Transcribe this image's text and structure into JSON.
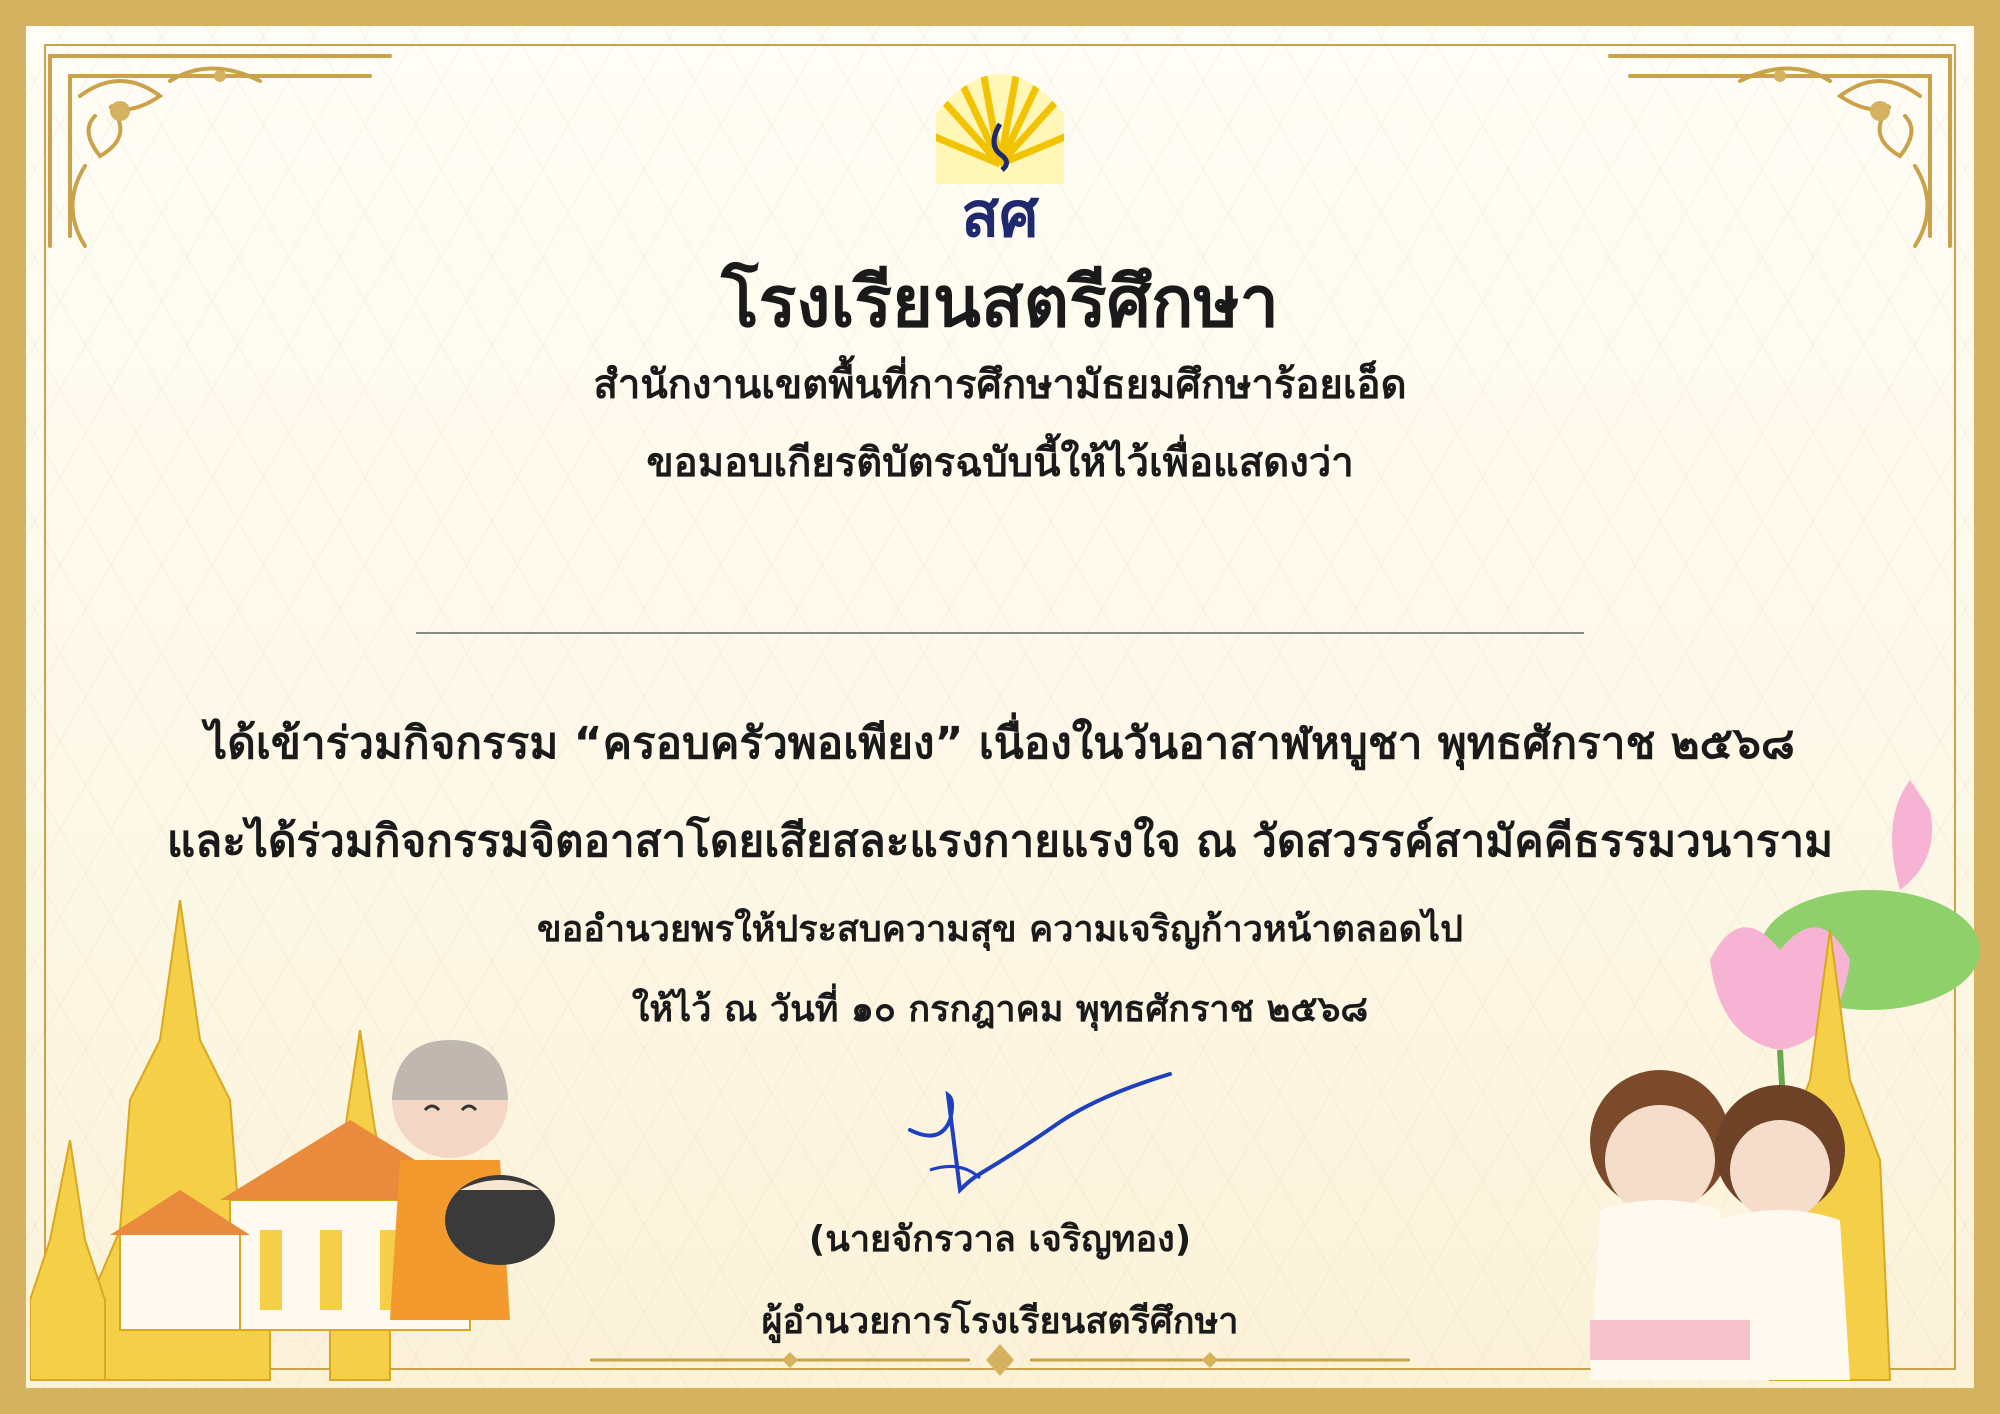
{
  "certificate": {
    "school_name": "โรงเรียนสตรีศึกษา",
    "office_name": "สำนักงานเขตพื้นที่การศึกษามัธยมศึกษาร้อยเอ็ด",
    "presentation_text": "ขอมอบเกียรติบัตรฉบับนี้ให้ไว้เพื่อแสดงว่า",
    "body_line1": "ได้เข้าร่วมกิจกรรม “ครอบครัวพอเพียง” เนื่องในวันอาสาฬหบูชา พุทธศักราช ๒๕๖๘",
    "body_line2": "และได้ร่วมกิจกรรมจิตอาสาโดยเสียสละแรงกายแรงใจ ณ วัดสวรรค์สามัคคีธรรมวนาราม",
    "wish_text": "ขออำนวยพรให้ประสบความสุข ความเจริญก้าวหน้าตลอดไป",
    "date_text": "ให้ไว้ ณ วันที่ ๑๐ กรกฎาคม พุทธศักราช ๒๕๖๘",
    "signer_name": "(นายจักรวาล เจริญทอง)",
    "signer_position": "ผู้อำนวยการโรงเรียนสตรีศึกษา"
  },
  "logo": {
    "text": "สศ",
    "icon": "school-emblem-icon"
  },
  "colors": {
    "border_gold": "#d4b260",
    "logo_navy": "#1f2a6e",
    "logo_yellow": "#f2c300",
    "signature_blue": "#1e3fbf"
  }
}
